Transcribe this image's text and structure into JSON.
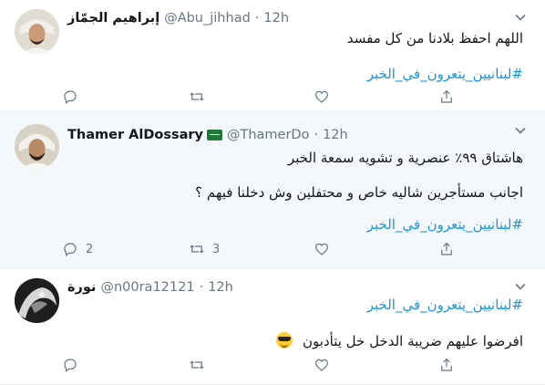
{
  "tweets": [
    {
      "name": "إبراهيم الجمّاز",
      "handle": "@Abu_jihhad",
      "time": "12h",
      "lines": [
        "اللهم احفظ بلادنا من كل مفسد"
      ],
      "hashtag": "#لبنانيين_يتعرون_في_الخبر",
      "actions": {
        "reply": "",
        "retweet": "",
        "like": "",
        "share": ""
      }
    },
    {
      "name": "Thamer AlDossary",
      "handle": "@ThamerDo",
      "time": "12h",
      "lines": [
        "هاشتاق ٩٩٪ عنصرية و تشويه سمعة الخبر",
        "اجانب مستأجرين شاليه خاص و محتفلين وش دخلنا فيهم ؟"
      ],
      "hashtag": "#لبنانيين_يتعرون_في_الخبر",
      "actions": {
        "reply": "2",
        "retweet": "3",
        "like": "",
        "share": ""
      }
    },
    {
      "name": "نورة",
      "handle": "@n00ra12121",
      "time": "12h",
      "hashtag": "#لبنانيين_يتعرون_في_الخبر",
      "lines": [
        "افرضوا عليهم ضريبة الدخل خل يتأدبون"
      ],
      "actions": {
        "reply": "",
        "retweet": "",
        "like": "",
        "share": ""
      }
    }
  ],
  "separator": "·",
  "colors": {
    "link": "#1b95e0",
    "muted": "#657786",
    "highlight_bg": "#f5f8fa"
  },
  "icons": [
    "chevron-down-icon",
    "reply-icon",
    "retweet-icon",
    "like-icon",
    "share-icon",
    "saudi-flag-icon",
    "sunglasses-emoji-icon"
  ]
}
